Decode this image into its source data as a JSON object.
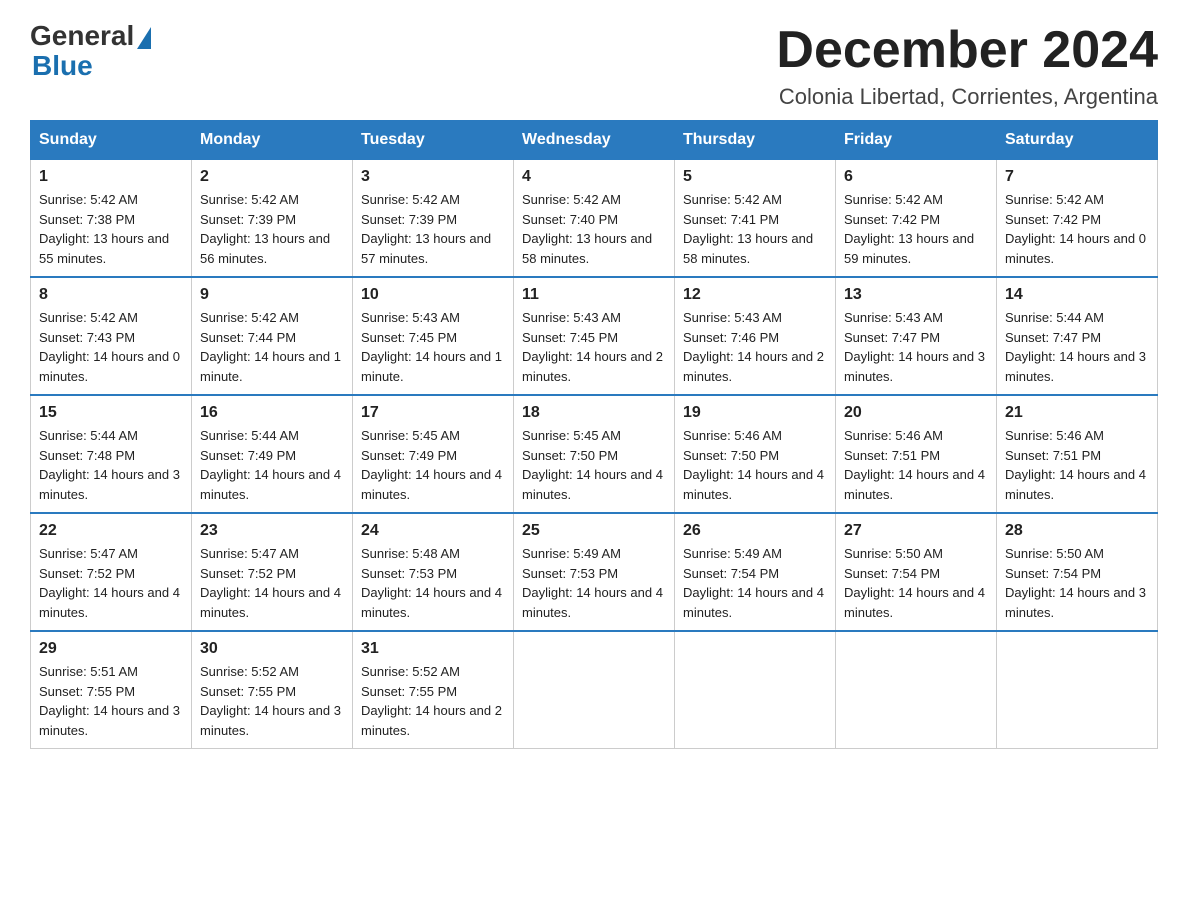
{
  "logo": {
    "general": "General",
    "blue": "Blue"
  },
  "title": "December 2024",
  "location": "Colonia Libertad, Corrientes, Argentina",
  "days_of_week": [
    "Sunday",
    "Monday",
    "Tuesday",
    "Wednesday",
    "Thursday",
    "Friday",
    "Saturday"
  ],
  "weeks": [
    [
      {
        "day": "1",
        "sunrise": "5:42 AM",
        "sunset": "7:38 PM",
        "daylight": "13 hours and 55 minutes."
      },
      {
        "day": "2",
        "sunrise": "5:42 AM",
        "sunset": "7:39 PM",
        "daylight": "13 hours and 56 minutes."
      },
      {
        "day": "3",
        "sunrise": "5:42 AM",
        "sunset": "7:39 PM",
        "daylight": "13 hours and 57 minutes."
      },
      {
        "day": "4",
        "sunrise": "5:42 AM",
        "sunset": "7:40 PM",
        "daylight": "13 hours and 58 minutes."
      },
      {
        "day": "5",
        "sunrise": "5:42 AM",
        "sunset": "7:41 PM",
        "daylight": "13 hours and 58 minutes."
      },
      {
        "day": "6",
        "sunrise": "5:42 AM",
        "sunset": "7:42 PM",
        "daylight": "13 hours and 59 minutes."
      },
      {
        "day": "7",
        "sunrise": "5:42 AM",
        "sunset": "7:42 PM",
        "daylight": "14 hours and 0 minutes."
      }
    ],
    [
      {
        "day": "8",
        "sunrise": "5:42 AM",
        "sunset": "7:43 PM",
        "daylight": "14 hours and 0 minutes."
      },
      {
        "day": "9",
        "sunrise": "5:42 AM",
        "sunset": "7:44 PM",
        "daylight": "14 hours and 1 minute."
      },
      {
        "day": "10",
        "sunrise": "5:43 AM",
        "sunset": "7:45 PM",
        "daylight": "14 hours and 1 minute."
      },
      {
        "day": "11",
        "sunrise": "5:43 AM",
        "sunset": "7:45 PM",
        "daylight": "14 hours and 2 minutes."
      },
      {
        "day": "12",
        "sunrise": "5:43 AM",
        "sunset": "7:46 PM",
        "daylight": "14 hours and 2 minutes."
      },
      {
        "day": "13",
        "sunrise": "5:43 AM",
        "sunset": "7:47 PM",
        "daylight": "14 hours and 3 minutes."
      },
      {
        "day": "14",
        "sunrise": "5:44 AM",
        "sunset": "7:47 PM",
        "daylight": "14 hours and 3 minutes."
      }
    ],
    [
      {
        "day": "15",
        "sunrise": "5:44 AM",
        "sunset": "7:48 PM",
        "daylight": "14 hours and 3 minutes."
      },
      {
        "day": "16",
        "sunrise": "5:44 AM",
        "sunset": "7:49 PM",
        "daylight": "14 hours and 4 minutes."
      },
      {
        "day": "17",
        "sunrise": "5:45 AM",
        "sunset": "7:49 PM",
        "daylight": "14 hours and 4 minutes."
      },
      {
        "day": "18",
        "sunrise": "5:45 AM",
        "sunset": "7:50 PM",
        "daylight": "14 hours and 4 minutes."
      },
      {
        "day": "19",
        "sunrise": "5:46 AM",
        "sunset": "7:50 PM",
        "daylight": "14 hours and 4 minutes."
      },
      {
        "day": "20",
        "sunrise": "5:46 AM",
        "sunset": "7:51 PM",
        "daylight": "14 hours and 4 minutes."
      },
      {
        "day": "21",
        "sunrise": "5:46 AM",
        "sunset": "7:51 PM",
        "daylight": "14 hours and 4 minutes."
      }
    ],
    [
      {
        "day": "22",
        "sunrise": "5:47 AM",
        "sunset": "7:52 PM",
        "daylight": "14 hours and 4 minutes."
      },
      {
        "day": "23",
        "sunrise": "5:47 AM",
        "sunset": "7:52 PM",
        "daylight": "14 hours and 4 minutes."
      },
      {
        "day": "24",
        "sunrise": "5:48 AM",
        "sunset": "7:53 PM",
        "daylight": "14 hours and 4 minutes."
      },
      {
        "day": "25",
        "sunrise": "5:49 AM",
        "sunset": "7:53 PM",
        "daylight": "14 hours and 4 minutes."
      },
      {
        "day": "26",
        "sunrise": "5:49 AM",
        "sunset": "7:54 PM",
        "daylight": "14 hours and 4 minutes."
      },
      {
        "day": "27",
        "sunrise": "5:50 AM",
        "sunset": "7:54 PM",
        "daylight": "14 hours and 4 minutes."
      },
      {
        "day": "28",
        "sunrise": "5:50 AM",
        "sunset": "7:54 PM",
        "daylight": "14 hours and 3 minutes."
      }
    ],
    [
      {
        "day": "29",
        "sunrise": "5:51 AM",
        "sunset": "7:55 PM",
        "daylight": "14 hours and 3 minutes."
      },
      {
        "day": "30",
        "sunrise": "5:52 AM",
        "sunset": "7:55 PM",
        "daylight": "14 hours and 3 minutes."
      },
      {
        "day": "31",
        "sunrise": "5:52 AM",
        "sunset": "7:55 PM",
        "daylight": "14 hours and 2 minutes."
      },
      null,
      null,
      null,
      null
    ]
  ],
  "labels": {
    "sunrise": "Sunrise:",
    "sunset": "Sunset:",
    "daylight": "Daylight:"
  }
}
